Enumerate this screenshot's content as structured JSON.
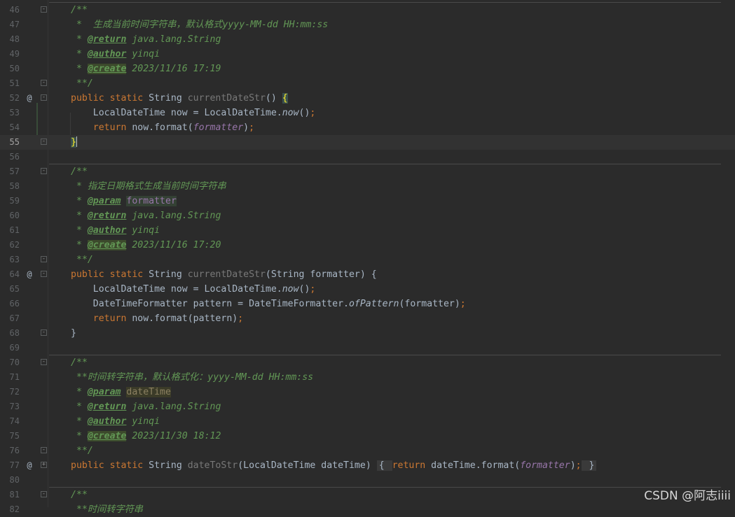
{
  "lines": [
    {
      "n": "46",
      "fold": "-",
      "parts": [
        {
          "t": "/**",
          "c": "doc"
        }
      ]
    },
    {
      "n": "47",
      "parts": [
        {
          "t": " *  生成当前时间字符串，默认格式yyyy-MM-dd HH:mm:ss",
          "c": "doc"
        }
      ]
    },
    {
      "n": "48",
      "parts": [
        {
          "t": " * ",
          "c": "doc"
        },
        {
          "t": "@return",
          "c": "dt"
        },
        {
          "t": " java.lang.String",
          "c": "doc"
        }
      ]
    },
    {
      "n": "49",
      "parts": [
        {
          "t": " * ",
          "c": "doc"
        },
        {
          "t": "@author",
          "c": "dt"
        },
        {
          "t": " yinqi",
          "c": "doc"
        }
      ]
    },
    {
      "n": "50",
      "parts": [
        {
          "t": " * ",
          "c": "doc"
        },
        {
          "t": "@create",
          "c": "dt dt-hl"
        },
        {
          "t": " 2023/11/16 17:19",
          "c": "doc"
        }
      ]
    },
    {
      "n": "51",
      "fold": "-",
      "parts": [
        {
          "t": " **/",
          "c": "doc"
        }
      ]
    },
    {
      "n": "52",
      "marker": "@",
      "fold": "-",
      "parts": [
        {
          "t": "public static ",
          "c": "kw"
        },
        {
          "t": "String "
        },
        {
          "t": "currentDateStr",
          "c": "mu"
        },
        {
          "t": "() ",
          "c": "br"
        },
        {
          "t": "{",
          "c": "bm"
        }
      ]
    },
    {
      "n": "53",
      "parts": [
        {
          "t": "    LocalDateTime now = LocalDateTime."
        },
        {
          "t": "now",
          "c": "st"
        },
        {
          "t": "()",
          "c": "br"
        },
        {
          "t": ";",
          "c": "kw"
        }
      ]
    },
    {
      "n": "54",
      "parts": [
        {
          "t": "    "
        },
        {
          "t": "return ",
          "c": "kw"
        },
        {
          "t": "now.format("
        },
        {
          "t": "formatter",
          "c": "fi"
        },
        {
          "t": ")"
        },
        {
          "t": ";",
          "c": "kw"
        }
      ]
    },
    {
      "n": "55",
      "current": true,
      "fold": "-",
      "parts": [
        {
          "t": "}",
          "c": "bm"
        },
        {
          "cursor": true
        }
      ]
    },
    {
      "n": "56",
      "parts": []
    },
    {
      "n": "57",
      "fold": "-",
      "parts": [
        {
          "t": "/**",
          "c": "doc"
        }
      ]
    },
    {
      "n": "58",
      "parts": [
        {
          "t": " * 指定日期格式生成当前时间字符串",
          "c": "doc"
        }
      ]
    },
    {
      "n": "59",
      "parts": [
        {
          "t": " * ",
          "c": "doc"
        },
        {
          "t": "@param",
          "c": "dt"
        },
        {
          "t": " ",
          "c": "doc"
        },
        {
          "t": "formatter",
          "c": "doc pn"
        }
      ]
    },
    {
      "n": "60",
      "parts": [
        {
          "t": " * ",
          "c": "doc"
        },
        {
          "t": "@return",
          "c": "dt"
        },
        {
          "t": " java.lang.String",
          "c": "doc"
        }
      ]
    },
    {
      "n": "61",
      "parts": [
        {
          "t": " * ",
          "c": "doc"
        },
        {
          "t": "@author",
          "c": "dt"
        },
        {
          "t": " yinqi",
          "c": "doc"
        }
      ]
    },
    {
      "n": "62",
      "parts": [
        {
          "t": " * ",
          "c": "doc"
        },
        {
          "t": "@create",
          "c": "dt dt-hl"
        },
        {
          "t": " 2023/11/16 17:20",
          "c": "doc"
        }
      ]
    },
    {
      "n": "63",
      "fold": "-",
      "parts": [
        {
          "t": " **/",
          "c": "doc"
        }
      ]
    },
    {
      "n": "64",
      "marker": "@",
      "fold": "-",
      "parts": [
        {
          "t": "public static ",
          "c": "kw"
        },
        {
          "t": "String "
        },
        {
          "t": "currentDateStr",
          "c": "mu"
        },
        {
          "t": "(String formatter) {"
        }
      ]
    },
    {
      "n": "65",
      "parts": [
        {
          "t": "    LocalDateTime now = LocalDateTime."
        },
        {
          "t": "now",
          "c": "st"
        },
        {
          "t": "()"
        },
        {
          "t": ";",
          "c": "kw"
        }
      ]
    },
    {
      "n": "66",
      "parts": [
        {
          "t": "    DateTimeFormatter pattern = DateTimeFormatter."
        },
        {
          "t": "ofPattern",
          "c": "st"
        },
        {
          "t": "(formatter)"
        },
        {
          "t": ";",
          "c": "kw"
        }
      ]
    },
    {
      "n": "67",
      "parts": [
        {
          "t": "    "
        },
        {
          "t": "return ",
          "c": "kw"
        },
        {
          "t": "now.format(pattern)"
        },
        {
          "t": ";",
          "c": "kw"
        }
      ]
    },
    {
      "n": "68",
      "fold": "-",
      "parts": [
        {
          "t": "}"
        }
      ]
    },
    {
      "n": "69",
      "parts": []
    },
    {
      "n": "70",
      "fold": "-",
      "parts": [
        {
          "t": "/**",
          "c": "doc"
        }
      ]
    },
    {
      "n": "71",
      "parts": [
        {
          "t": " **时间转字符串，默认格式化：yyyy-MM-dd HH:mm:ss",
          "c": "doc"
        }
      ]
    },
    {
      "n": "72",
      "parts": [
        {
          "t": " * ",
          "c": "doc"
        },
        {
          "t": "@param",
          "c": "dt"
        },
        {
          "t": " ",
          "c": "doc"
        },
        {
          "t": "dateTime",
          "c": "doc pn2"
        }
      ]
    },
    {
      "n": "73",
      "parts": [
        {
          "t": " * ",
          "c": "doc"
        },
        {
          "t": "@return",
          "c": "dt"
        },
        {
          "t": " java.lang.String",
          "c": "doc"
        }
      ]
    },
    {
      "n": "74",
      "parts": [
        {
          "t": " * ",
          "c": "doc"
        },
        {
          "t": "@author",
          "c": "dt"
        },
        {
          "t": " yinqi",
          "c": "doc"
        }
      ]
    },
    {
      "n": "75",
      "parts": [
        {
          "t": " * ",
          "c": "doc"
        },
        {
          "t": "@create",
          "c": "dt dt-hl"
        },
        {
          "t": " 2023/11/30 18:12",
          "c": "doc"
        }
      ]
    },
    {
      "n": "76",
      "fold": "-",
      "parts": [
        {
          "t": " **/",
          "c": "doc"
        }
      ]
    },
    {
      "n": "77",
      "marker": "@",
      "fold": "+",
      "parts": [
        {
          "t": "public static ",
          "c": "kw"
        },
        {
          "t": "String "
        },
        {
          "t": "dateToStr",
          "c": "mu"
        },
        {
          "t": "(LocalDateTime dateTime) "
        },
        {
          "t": "{ ",
          "c": "foldbox"
        },
        {
          "t": "return ",
          "c": "kw"
        },
        {
          "t": "dateTime.format("
        },
        {
          "t": "formatter",
          "c": "fi"
        },
        {
          "t": ")"
        },
        {
          "t": ";",
          "c": "kw"
        },
        {
          "t": " }",
          "c": "foldbox"
        }
      ]
    },
    {
      "n": "80",
      "parts": []
    },
    {
      "n": "81",
      "fold": "-",
      "parts": [
        {
          "t": "/**",
          "c": "doc"
        }
      ]
    },
    {
      "n": "82",
      "parts": [
        {
          "t": " **时间转字符串",
          "c": "doc"
        }
      ]
    }
  ],
  "watermark": "CSDN @阿志iiii"
}
